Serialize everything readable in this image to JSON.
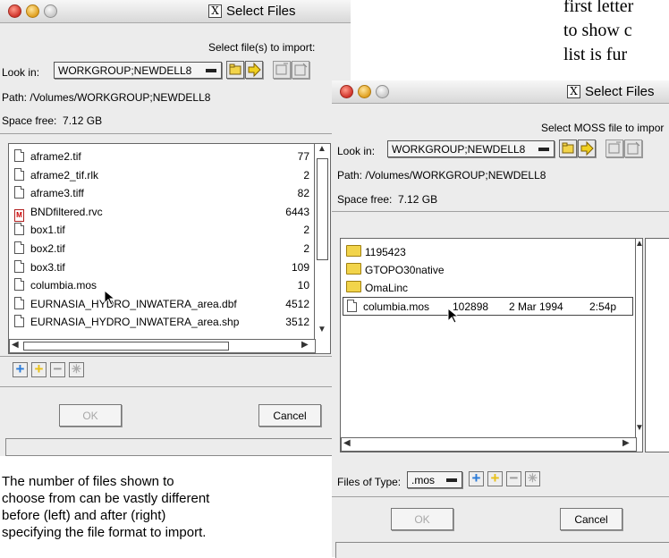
{
  "background_text": [
    "first letter",
    "to show c",
    "list is fur"
  ],
  "left_window": {
    "title": "Select Files",
    "heading": "Select file(s) to import:",
    "look_in_label": "Look in:",
    "look_in_value": "WORKGROUP;NEWDELL8",
    "path_label": "Path:",
    "path_value": "/Volumes/WORKGROUP;NEWDELL8",
    "space_label": "Space free:",
    "space_value": "7.12 GB",
    "files": [
      {
        "name": "aframe2.tif",
        "size": "77",
        "icon": "document-icon"
      },
      {
        "name": "aframe2_tif.rlk",
        "size": "2",
        "icon": "document-icon"
      },
      {
        "name": "aframe3.tiff",
        "size": "82",
        "icon": "document-icon"
      },
      {
        "name": "BNDfiltered.rvc",
        "size": "6443",
        "icon": "mi-document-icon"
      },
      {
        "name": "box1.tif",
        "size": "2",
        "icon": "document-icon"
      },
      {
        "name": "box2.tif",
        "size": "2",
        "icon": "document-icon"
      },
      {
        "name": "box3.tif",
        "size": "109",
        "icon": "document-icon"
      },
      {
        "name": "columbia.mos",
        "size": "10",
        "icon": "document-icon"
      },
      {
        "name": "EURNASIA_HYDRO_INWATERA_area.dbf",
        "size": "4512",
        "icon": "document-icon"
      },
      {
        "name": "EURNASIA_HYDRO_INWATERA_area.shp",
        "size": "3512",
        "icon": "document-icon"
      }
    ],
    "ok_label": "OK",
    "cancel_label": "Cancel"
  },
  "right_window": {
    "title": "Select Files",
    "heading": "Select MOSS file to impor",
    "look_in_label": "Look in:",
    "look_in_value": "WORKGROUP;NEWDELL8",
    "path_label": "Path:",
    "path_value": "/Volumes/WORKGROUP;NEWDELL8",
    "space_label": "Space free:",
    "space_value": "7.12 GB",
    "folders": [
      "1195423",
      "GTOPO30native",
      "OmaLinc"
    ],
    "file": {
      "name": "columbia.mos",
      "size": "102898",
      "date": "2 Mar 1994",
      "time": "2:54p"
    },
    "files_of_type_label": "Files of Type:",
    "files_of_type_value": ".mos",
    "ok_label": "OK",
    "cancel_label": "Cancel"
  },
  "caption": [
    "The number of files shown to",
    "choose from can be vastly different",
    "before (left) and after (right)",
    "specifying the file format to import."
  ],
  "colors": {
    "add_blue": "#2a7ad8",
    "add_yellow": "#e8c018",
    "folder": "#f2d44a"
  }
}
